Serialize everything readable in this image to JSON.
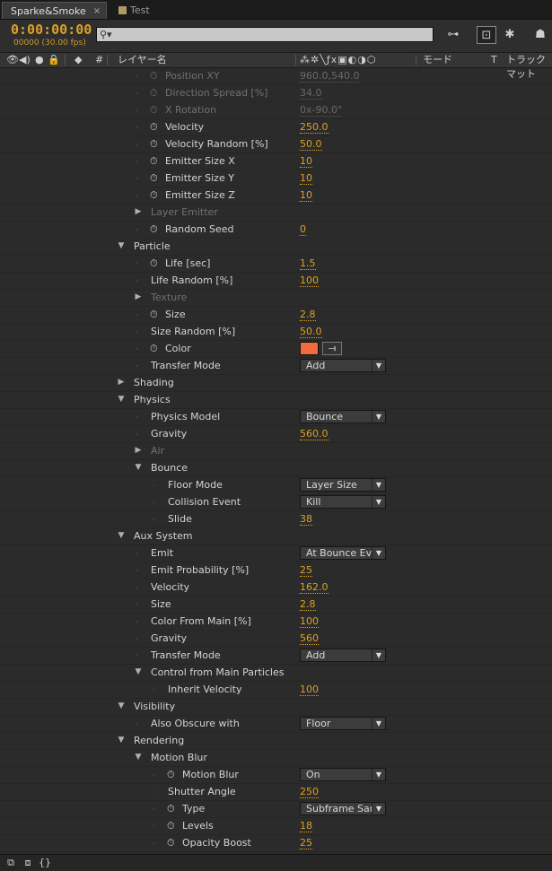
{
  "tabs": [
    {
      "label": "Sparke&Smoke",
      "active": true
    },
    {
      "label": "Test",
      "active": false
    }
  ],
  "header": {
    "timecode": "0:00:00:00",
    "frames": "00000 (30.00 fps)",
    "search_placeholder": ""
  },
  "columns": {
    "switch_hash": "#",
    "layer_name": "レイヤー名",
    "mode": "モード",
    "t": "T",
    "trackmat": "トラックマット"
  },
  "accent_color": "#e0a020",
  "color_swatch": "#f26a3d",
  "rows": [
    {
      "label": "Position XY",
      "value": "960.0,540.0",
      "indent": 1,
      "stopwatch": true,
      "dim": true
    },
    {
      "label": "Direction Spread [%]",
      "value": "34.0",
      "indent": 1,
      "stopwatch": true,
      "dim": true
    },
    {
      "label": "X Rotation",
      "value": "0x-90.0°",
      "indent": 1,
      "stopwatch": true,
      "dim": true
    },
    {
      "label": "Velocity",
      "value": "250.0",
      "indent": 1,
      "stopwatch": true
    },
    {
      "label": "Velocity Random [%]",
      "value": "50.0",
      "indent": 1,
      "stopwatch": true
    },
    {
      "label": "Emitter Size X",
      "value": "10",
      "indent": 1,
      "stopwatch": true
    },
    {
      "label": "Emitter Size Y",
      "value": "10",
      "indent": 1,
      "stopwatch": true
    },
    {
      "label": "Emitter Size Z",
      "value": "10",
      "indent": 1,
      "stopwatch": true
    },
    {
      "label": "Layer Emitter",
      "indent": 1,
      "expander": "closed",
      "dim": true
    },
    {
      "label": "Random Seed",
      "value": "0",
      "indent": 1,
      "stopwatch": true
    },
    {
      "label": "Particle",
      "indent": 0,
      "expander": "open"
    },
    {
      "label": "Life [sec]",
      "value": "1.5",
      "indent": 1,
      "stopwatch": true
    },
    {
      "label": "Life Random [%]",
      "value": "100",
      "indent": 1
    },
    {
      "label": "Texture",
      "indent": 1,
      "expander": "closed",
      "dim": true
    },
    {
      "label": "Size",
      "value": "2.8",
      "indent": 1,
      "stopwatch": true
    },
    {
      "label": "Size Random [%]",
      "value": "50.0",
      "indent": 1
    },
    {
      "label": "Color",
      "indent": 1,
      "stopwatch": true,
      "color": true
    },
    {
      "label": "Transfer Mode",
      "dropdown": "Add",
      "indent": 1
    },
    {
      "label": "Shading",
      "indent": 0,
      "expander": "closed"
    },
    {
      "label": "Physics",
      "indent": 0,
      "expander": "open"
    },
    {
      "label": "Physics Model",
      "dropdown": "Bounce",
      "indent": 1
    },
    {
      "label": "Gravity",
      "value": "560.0",
      "indent": 1
    },
    {
      "label": "Air",
      "indent": 1,
      "expander": "closed",
      "dim": true
    },
    {
      "label": "Bounce",
      "indent": 1,
      "expander": "open"
    },
    {
      "label": "Floor Mode",
      "dropdown": "Layer Size",
      "indent": 2
    },
    {
      "label": "Collision Event",
      "dropdown": "Kill",
      "indent": 2
    },
    {
      "label": "Slide",
      "value": "38",
      "indent": 2
    },
    {
      "label": "Aux System",
      "indent": 0,
      "expander": "open"
    },
    {
      "label": "Emit",
      "dropdown": "At Bounce Event",
      "indent": 1
    },
    {
      "label": "Emit Probability [%]",
      "value": "25",
      "indent": 1
    },
    {
      "label": "Velocity",
      "value": "162.0",
      "indent": 1
    },
    {
      "label": "Size",
      "value": "2.8",
      "indent": 1
    },
    {
      "label": "Color From Main [%]",
      "value": "100",
      "indent": 1
    },
    {
      "label": "Gravity",
      "value": "560",
      "indent": 1
    },
    {
      "label": "Transfer Mode",
      "dropdown": "Add",
      "indent": 1
    },
    {
      "label": "Control from Main Particles",
      "indent": 1,
      "expander": "open"
    },
    {
      "label": "Inherit Velocity",
      "value": "100",
      "indent": 2
    },
    {
      "label": "Visibility",
      "indent": 0,
      "expander": "open"
    },
    {
      "label": "Also Obscure with",
      "dropdown": "Floor",
      "indent": 1
    },
    {
      "label": "Rendering",
      "indent": 0,
      "expander": "open"
    },
    {
      "label": "Motion Blur",
      "indent": 1,
      "expander": "open"
    },
    {
      "label": "Motion Blur",
      "dropdown": "On",
      "indent": 2,
      "stopwatch": true
    },
    {
      "label": "Shutter Angle",
      "value": "250",
      "indent": 2
    },
    {
      "label": "Type",
      "dropdown": "Subframe Sample",
      "indent": 2,
      "stopwatch": true
    },
    {
      "label": "Levels",
      "value": "18",
      "indent": 2,
      "stopwatch": true
    },
    {
      "label": "Opacity Boost",
      "value": "25",
      "indent": 2,
      "stopwatch": true
    }
  ]
}
